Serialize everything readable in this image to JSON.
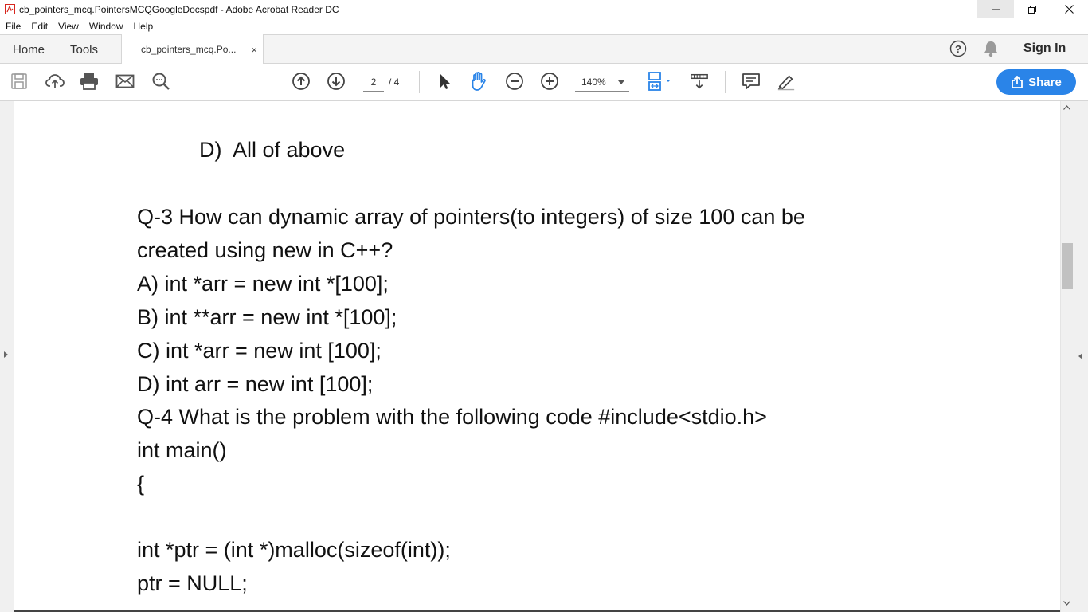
{
  "window": {
    "title": "cb_pointers_mcq.PointersMCQGoogleDocspdf - Adobe Acrobat Reader DC"
  },
  "menu": [
    "File",
    "Edit",
    "View",
    "Window",
    "Help"
  ],
  "tabs": {
    "home": "Home",
    "tools": "Tools",
    "document": "cb_pointers_mcq.Po...",
    "close": "×"
  },
  "header": {
    "sign_in": "Sign In"
  },
  "toolbar": {
    "page_current": "2",
    "page_total": "/ 4",
    "zoom": "140%",
    "share": "Share"
  },
  "document": {
    "lines": [
      "D)  All of above",
      "Q-3 How can dynamic array of pointers(to integers) of size 100 can be",
      "created using new in C++?",
      "A) int *arr = new int *[100];",
      "B) int **arr = new int *[100];",
      "C) int *arr = new int [100];",
      "D) int arr = new int [100];",
      "Q-4 What is the problem with the following code #include<stdio.h>",
      "int main()",
      "{",
      "int *ptr = (int *)malloc(sizeof(int));",
      "ptr = NULL;"
    ]
  },
  "colors": {
    "accent": "#2a84e8",
    "pdf_icon": "#d7261e"
  }
}
